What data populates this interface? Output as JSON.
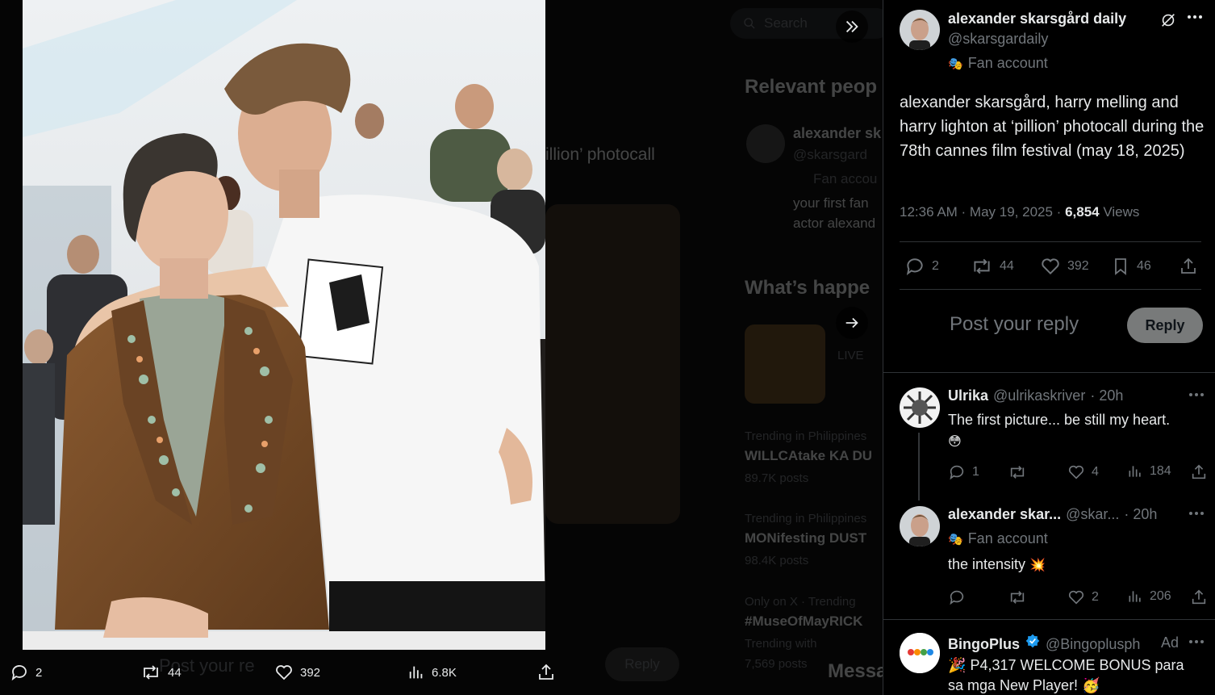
{
  "backdrop": {
    "search_placeholder": "Search",
    "relevant_people": "Relevant peop",
    "rp_name": "alexander sk",
    "rp_handle": "@skarsgard",
    "rp_badge": "Fan accou",
    "rp_bio1": "your first fan",
    "rp_bio2": "actor alexand",
    "post_fragment": "illion’ photocall",
    "whats_happening": "What’s happe",
    "live": "LIVE",
    "trend1_label": "Trending in Philippines",
    "trend1_title": "WILLCAtake KA DU",
    "trend1_count": "89.7K posts",
    "trend2_label": "Trending in Philippines",
    "trend2_title": "MONifesting DUST",
    "trend2_count": "98.4K posts",
    "trend3_label": "Only on X · Trending",
    "trend3_title": "#MuseOfMayRICK",
    "trend3_sub": "Trending with",
    "trend3_count": "7,569 posts",
    "reply_ghost": "Post your re",
    "reply_btn_ghost": "Reply",
    "messages": "Messa"
  },
  "media_bar": {
    "replies": "2",
    "reposts": "44",
    "likes": "392",
    "views": "6.8K"
  },
  "post": {
    "author_name": "alexander skarsgård daily",
    "author_handle": "@skarsgardaily",
    "author_badge": "Fan account",
    "text": "alexander skarsgård, harry melling and harry lighton at ‘pillion’ photocall during the 78th cannes film festival (may 18, 2025)",
    "time": "12:36 AM · May 19, 2025 · ",
    "views_count": "6,854",
    "views_label": " Views",
    "replies": "2",
    "reposts": "44",
    "likes": "392",
    "bookmarks": "46"
  },
  "composer": {
    "placeholder": "Post your reply",
    "button": "Reply"
  },
  "replies": [
    {
      "name": "Ulrika",
      "handle": "@ulrikaskriver",
      "time": "· 20h",
      "text": "The first picture... be still my heart.",
      "emoji": "😳",
      "replies": "1",
      "reposts": "",
      "likes": "4",
      "views": "184"
    },
    {
      "name": "alexander skar...",
      "handle": "@skar...",
      "time": "· 20h",
      "badge": "Fan account",
      "text": "the intensity",
      "emoji": "💥",
      "replies": "",
      "reposts": "",
      "likes": "2",
      "views": "206"
    },
    {
      "name": "BingoPlus",
      "handle": "@Bingoplusph",
      "ad_label": "Ad",
      "emoji_lead": "🎉",
      "text": "P4,317 WELCOME BONUS para sa mga New Player!",
      "emoji_tail": "🥳"
    }
  ],
  "colors": {
    "accent_blue": "#1d9bf0",
    "muted": "#71767b",
    "border": "#2f3336",
    "reply_button_bg": "#787a7a"
  }
}
